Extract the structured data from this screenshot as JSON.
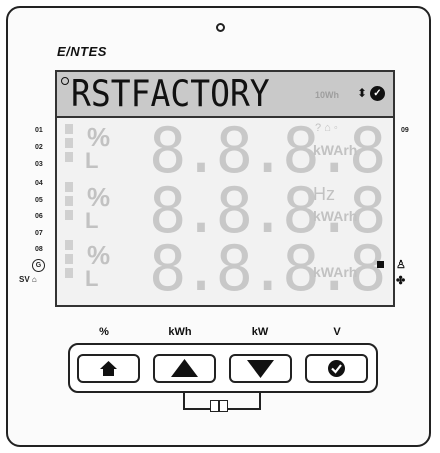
{
  "brand": "E/NTES",
  "display": {
    "main_text": "RSTFACTORY",
    "ghost_small": "10Wh",
    "ghost_digits": "8.8.8.8",
    "ghost_units": [
      "kWArh",
      "kWArh",
      "kWArh"
    ],
    "ghost_hz": "Hz"
  },
  "left_indicators": [
    "01",
    "02",
    "03",
    "04",
    "05",
    "06",
    "07",
    "08"
  ],
  "g_label": "G",
  "sv_label": "SV",
  "right_label": "09",
  "keys": [
    {
      "label": "%",
      "icon": "home-icon"
    },
    {
      "label": "kWh",
      "icon": "arrow-up-icon"
    },
    {
      "label": "kW",
      "icon": "arrow-down-icon"
    },
    {
      "label": "V",
      "icon": "check-icon"
    }
  ]
}
